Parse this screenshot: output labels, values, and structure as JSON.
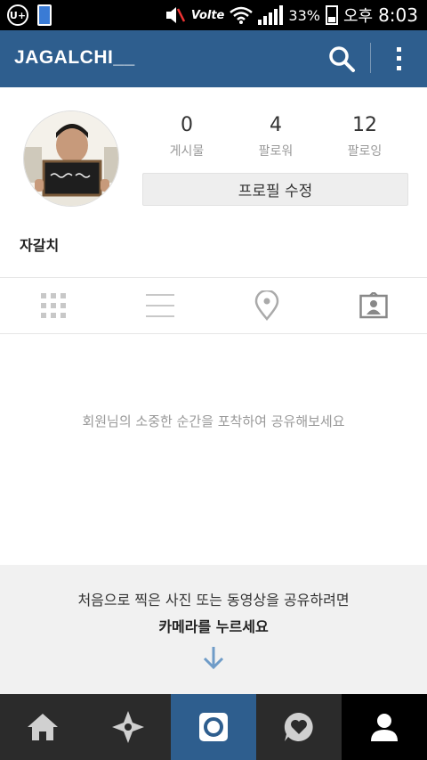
{
  "status_bar": {
    "carrier_icon": "U+",
    "lte": "Volte",
    "battery_percent": "33%",
    "ampm": "오후",
    "time": "8:03"
  },
  "app_bar": {
    "title": "JAGALCHI__",
    "search_icon": "search-icon",
    "more_icon": "more-vertical-icon"
  },
  "profile": {
    "stats": [
      {
        "count": "0",
        "label": "게시물"
      },
      {
        "count": "4",
        "label": "팔로워"
      },
      {
        "count": "12",
        "label": "팔로잉"
      }
    ],
    "edit_button": "프로필 수정",
    "username": "자갈치"
  },
  "view_tabs": [
    "grid-icon",
    "list-icon",
    "location-pin-icon",
    "tagged-photos-icon"
  ],
  "empty_message": "회원님의 소중한 순간을 포착하여 공유해보세요",
  "camera_prompt": {
    "line1": "처음으로 찍은 사진 또는 동영상을 공유하려면",
    "line2": "카메라를 누르세요"
  },
  "bottom_nav": [
    "home-icon",
    "explore-icon",
    "camera-icon",
    "activity-heart-icon",
    "profile-icon"
  ],
  "colors": {
    "brand_blue": "#2e5e8e",
    "nav_dark": "#2b2b2b",
    "prompt_bg": "#f1f1f1"
  }
}
